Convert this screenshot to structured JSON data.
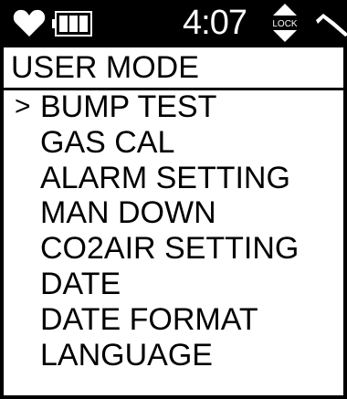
{
  "status_bar": {
    "time": "4:07",
    "lock_label": "LOCK",
    "icons": [
      "heart-icon",
      "battery-icon",
      "lock-icon",
      "signal-icon"
    ]
  },
  "title": "USER  MODE",
  "cursor": ">",
  "menu": {
    "selected_index": 0,
    "items": [
      {
        "label": "BUMP TEST"
      },
      {
        "label": "GAS CAL"
      },
      {
        "label": "ALARM SETTING"
      },
      {
        "label": "MAN DOWN"
      },
      {
        "label": "CO2AIR SETTING"
      },
      {
        "label": "DATE"
      },
      {
        "label": "DATE FORMAT"
      },
      {
        "label": "LANGUAGE"
      }
    ]
  },
  "colors": {
    "background": "#ffffff",
    "foreground": "#000000"
  }
}
